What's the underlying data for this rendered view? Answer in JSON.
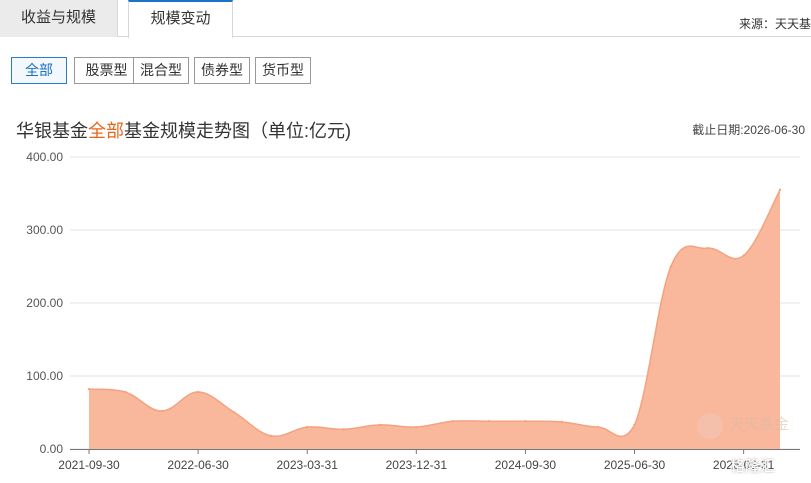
{
  "tabs": [
    {
      "label": "收益与规模",
      "active": false
    },
    {
      "label": "规模变动",
      "active": true
    }
  ],
  "source_text": "来源：天天基",
  "filters": [
    {
      "label": "全部",
      "active": true
    },
    {
      "label": "股票型",
      "active": false
    },
    {
      "label": "混合型",
      "active": false
    },
    {
      "label": "债券型",
      "active": false
    },
    {
      "label": "货币型",
      "active": false
    }
  ],
  "title": {
    "prefix": "华银基金",
    "highlight": "全部",
    "suffix": "基金规模走势图（单位:亿元)"
  },
  "cutoff_date": "截止日期:2026-06-30",
  "watermark": {
    "logo_text": "基金",
    "brand_text": "天天基金",
    "bottom_text": "格隆汇"
  },
  "colors": {
    "accent": "#1a73c8",
    "highlight": "#e8661a",
    "area_fill": "#f9b79b",
    "area_line": "#f4a27f"
  },
  "chart_data": {
    "type": "area",
    "title": "华银基金全部基金规模走势图（单位:亿元)",
    "xlabel": "",
    "ylabel": "",
    "x": [
      "2021-09-30",
      "2021-12-31",
      "2022-03-31",
      "2022-06-30",
      "2022-09-30",
      "2022-12-31",
      "2023-03-31",
      "2023-06-30",
      "2023-09-30",
      "2023-12-31",
      "2024-03-31",
      "2024-06-30",
      "2024-09-30",
      "2024-12-31",
      "2025-03-31",
      "2025-06-30",
      "2025-09-30",
      "2025-12-31",
      "2026-03-31",
      "2026-06-30"
    ],
    "series": [
      {
        "values": [
          82,
          78,
          52,
          78,
          50,
          18,
          30,
          27,
          33,
          30,
          38,
          38,
          38,
          37,
          30,
          33,
          250,
          275,
          265,
          355
        ]
      }
    ],
    "x_tick_labels": [
      "2021-09-30",
      "2022-06-30",
      "2023-03-31",
      "2023-12-31",
      "2024-09-30",
      "2025-06-30",
      "2026-03-31"
    ],
    "y_tick_labels": [
      "0.00",
      "100.00",
      "200.00",
      "300.00",
      "400.00"
    ],
    "ylim": [
      0,
      400
    ],
    "grid": true,
    "legend": "none"
  }
}
